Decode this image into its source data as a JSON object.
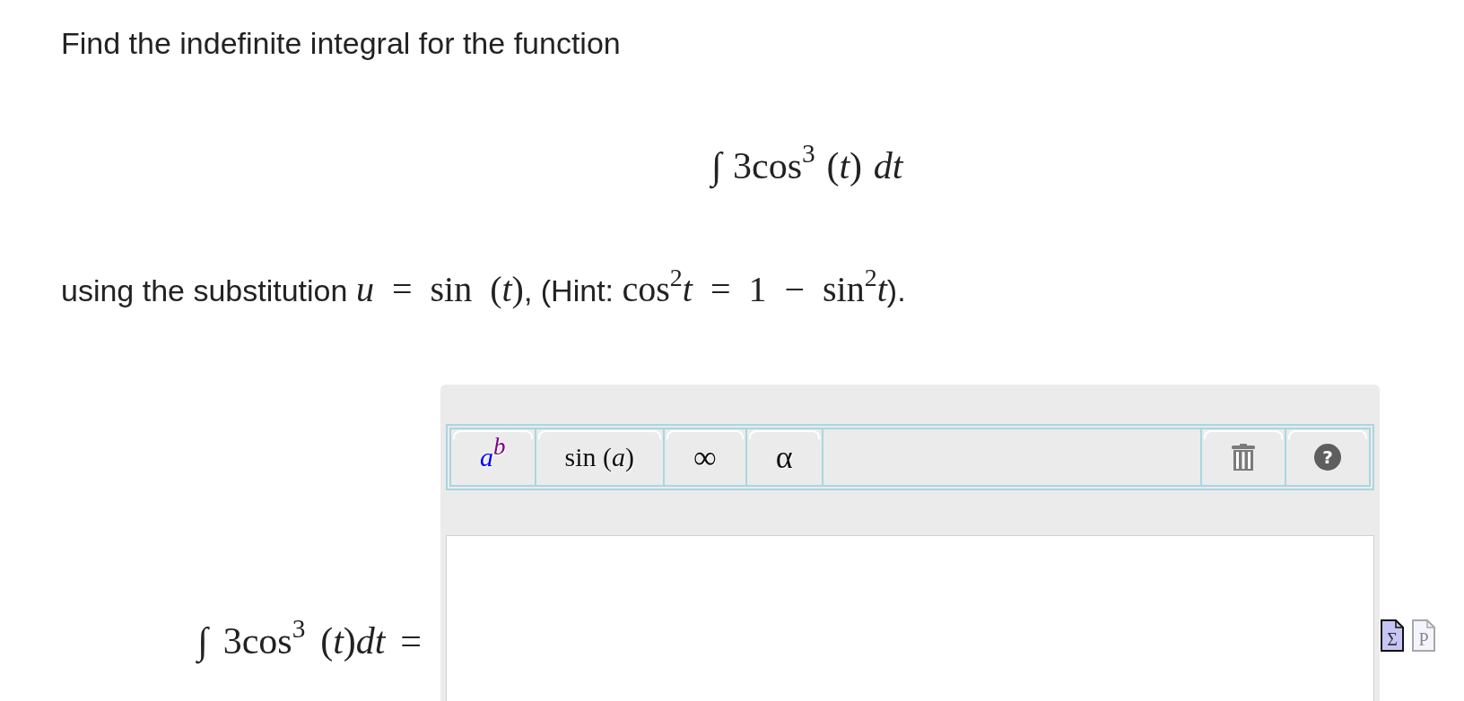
{
  "question": "Find the indefinite integral for the function",
  "integral": "∫ 3cos$^{3}$ (*t*) *dt*",
  "hint": [
    {
      "kind": "text",
      "text": "using the substitution "
    },
    {
      "kind": "math",
      "text": "*u* = sin (*t*)"
    },
    {
      "kind": "text",
      "text": ", (Hint: "
    },
    {
      "kind": "math",
      "text": "cos$^{2}$*t* = 1 − sin$^{2}$*t*"
    },
    {
      "kind": "text",
      "text": ")."
    }
  ],
  "answer": {
    "label": "∫ 3cos$^{3}$ (*t*)*dt* =",
    "toolbar": {
      "insert_buttons": [
        {
          "kind": "power",
          "base": "a",
          "exponent": "b"
        },
        {
          "kind": "function",
          "label": "sin (*a*)"
        },
        {
          "kind": "symbol",
          "symbol": "∞"
        },
        {
          "kind": "symbol",
          "symbol": "α"
        }
      ],
      "action_buttons": [
        {
          "kind": "delete"
        },
        {
          "kind": "help",
          "label": "?"
        }
      ]
    },
    "mode_icons": [
      {
        "glyph": "Σ",
        "selected": true
      },
      {
        "glyph": "P",
        "selected": false
      }
    ]
  }
}
